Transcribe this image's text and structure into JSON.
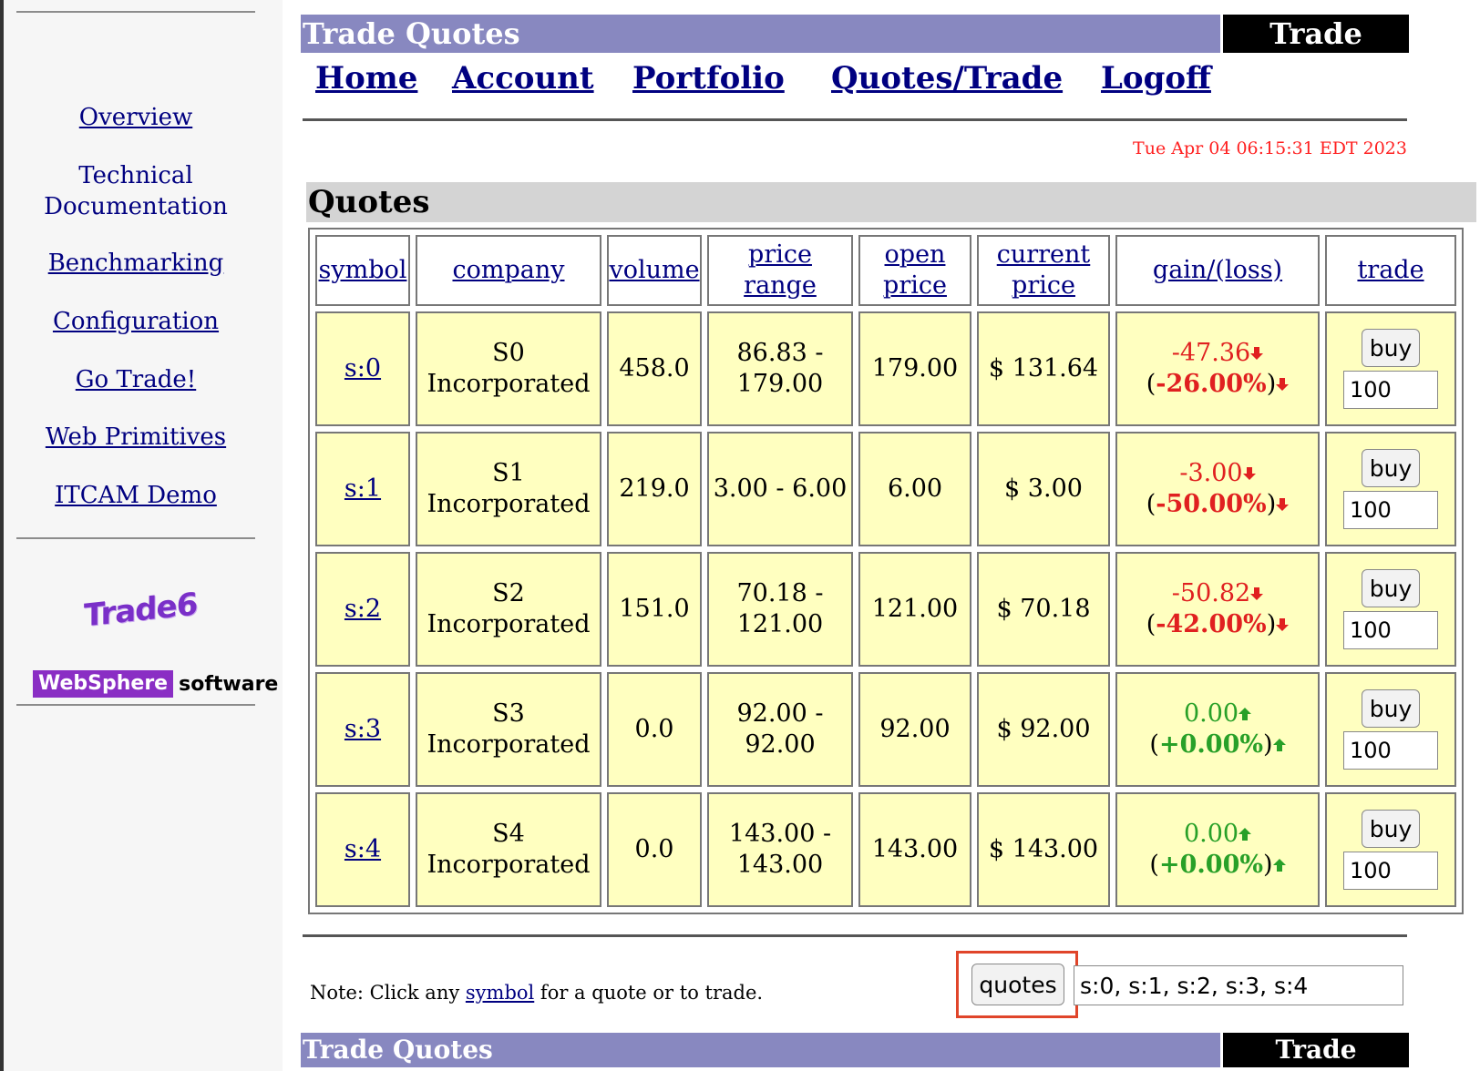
{
  "sidebar": {
    "links": [
      "Overview",
      "Technical Documentation",
      "Benchmarking",
      "Configuration",
      "Go Trade!",
      "Web Primitives",
      "ITCAM Demo"
    ],
    "logo_trade6": "Trade6",
    "logo_websphere_word": "WebSphere",
    "logo_websphere_software": "software"
  },
  "header": {
    "title": "Trade Quotes",
    "tag": "Trade",
    "nav": [
      "Home",
      "Account",
      "Portfolio",
      "Quotes/Trade",
      "Logoff"
    ],
    "timestamp": "Tue Apr 04 06:15:31 EDT 2023"
  },
  "quotes": {
    "title": "Quotes",
    "columns": [
      "symbol",
      "company",
      "volume",
      "price range",
      "open price",
      "current price",
      "gain/(loss)",
      "trade"
    ],
    "rows": [
      {
        "symbol": "s:0",
        "company_line1": "S0",
        "company_line2": "Incorporated",
        "volume": "458.0",
        "range_line1": "86.83 -",
        "range_line2": "179.00",
        "open": "179.00",
        "current": "$ 131.64",
        "gain": "-47.36",
        "pct_open": "(",
        "pct": "-26.00%",
        "pct_close": ")",
        "direction": "down",
        "buy_label": "buy",
        "qty": "100"
      },
      {
        "symbol": "s:1",
        "company_line1": "S1",
        "company_line2": "Incorporated",
        "volume": "219.0",
        "range_line1": "3.00 - 6.00",
        "range_line2": "",
        "open": "6.00",
        "current": "$ 3.00",
        "gain": "-3.00",
        "pct_open": "(",
        "pct": "-50.00%",
        "pct_close": ")",
        "direction": "down",
        "buy_label": "buy",
        "qty": "100"
      },
      {
        "symbol": "s:2",
        "company_line1": "S2",
        "company_line2": "Incorporated",
        "volume": "151.0",
        "range_line1": "70.18 -",
        "range_line2": "121.00",
        "open": "121.00",
        "current": "$ 70.18",
        "gain": "-50.82",
        "pct_open": "(",
        "pct": "-42.00%",
        "pct_close": ")",
        "direction": "down",
        "buy_label": "buy",
        "qty": "100"
      },
      {
        "symbol": "s:3",
        "company_line1": "S3",
        "company_line2": "Incorporated",
        "volume": "0.0",
        "range_line1": "92.00 -",
        "range_line2": "92.00",
        "open": "92.00",
        "current": "$ 92.00",
        "gain": "0.00",
        "pct_open": "(",
        "pct": "+0.00%",
        "pct_close": ")",
        "direction": "up",
        "buy_label": "buy",
        "qty": "100"
      },
      {
        "symbol": "s:4",
        "company_line1": "S4",
        "company_line2": "Incorporated",
        "volume": "0.0",
        "range_line1": "143.00 -",
        "range_line2": "143.00",
        "open": "143.00",
        "current": "$ 143.00",
        "gain": "0.00",
        "pct_open": "(",
        "pct": "+0.00%",
        "pct_close": ")",
        "direction": "up",
        "buy_label": "buy",
        "qty": "100"
      }
    ]
  },
  "footer": {
    "note_prefix": "Note: Click any ",
    "note_link": "symbol",
    "note_suffix": " for a quote or to trade.",
    "quotes_button": "quotes",
    "symbols_value": "s:0, s:1, s:2, s:3, s:4"
  },
  "bottom_banner": {
    "title": "Trade Quotes",
    "tag": "Trade"
  },
  "colors": {
    "loss": "#e02020",
    "gain": "#28a028",
    "banner": "#8888c0",
    "row_bg": "#ffffc0",
    "timestamp": "#ff2020",
    "highlight": "#e0452a"
  },
  "icons": {
    "down": "arrow-down-icon",
    "up": "arrow-up-icon"
  }
}
